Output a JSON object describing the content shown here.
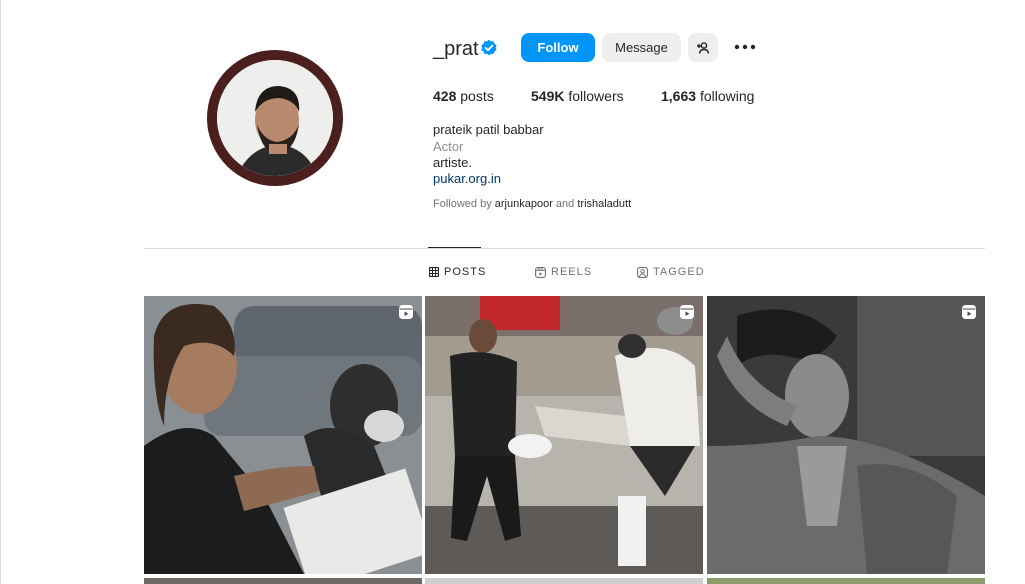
{
  "profile": {
    "username": "_prat",
    "full_name": "prateik patil babbar",
    "category": "Actor",
    "bio": "artiste.",
    "link": "pukar.org.in",
    "followed_by": {
      "prefix": "Followed by",
      "account_1": "arjunkapoor",
      "conjunction": "and",
      "account_2": "trishaladutt"
    },
    "avatar_ring_color": "#4a1f1d"
  },
  "actions": {
    "follow_label": "Follow",
    "message_label": "Message",
    "follow_color": "#0095f6"
  },
  "stats": {
    "posts_count": "428",
    "posts_label": "posts",
    "followers_count": "549K",
    "followers_label": "followers",
    "following_count": "1,663",
    "following_label": "following"
  },
  "tabs": [
    {
      "label": "POSTS",
      "icon": "grid-icon",
      "active": true
    },
    {
      "label": "REELS",
      "icon": "reels-icon",
      "active": false
    },
    {
      "label": "TAGGED",
      "icon": "tagged-icon",
      "active": false
    }
  ],
  "posts": [
    {
      "type": "reel",
      "description_icon": "reel-icon"
    },
    {
      "type": "reel",
      "description_icon": "reel-icon"
    },
    {
      "type": "reel",
      "description_icon": "reel-icon"
    }
  ]
}
